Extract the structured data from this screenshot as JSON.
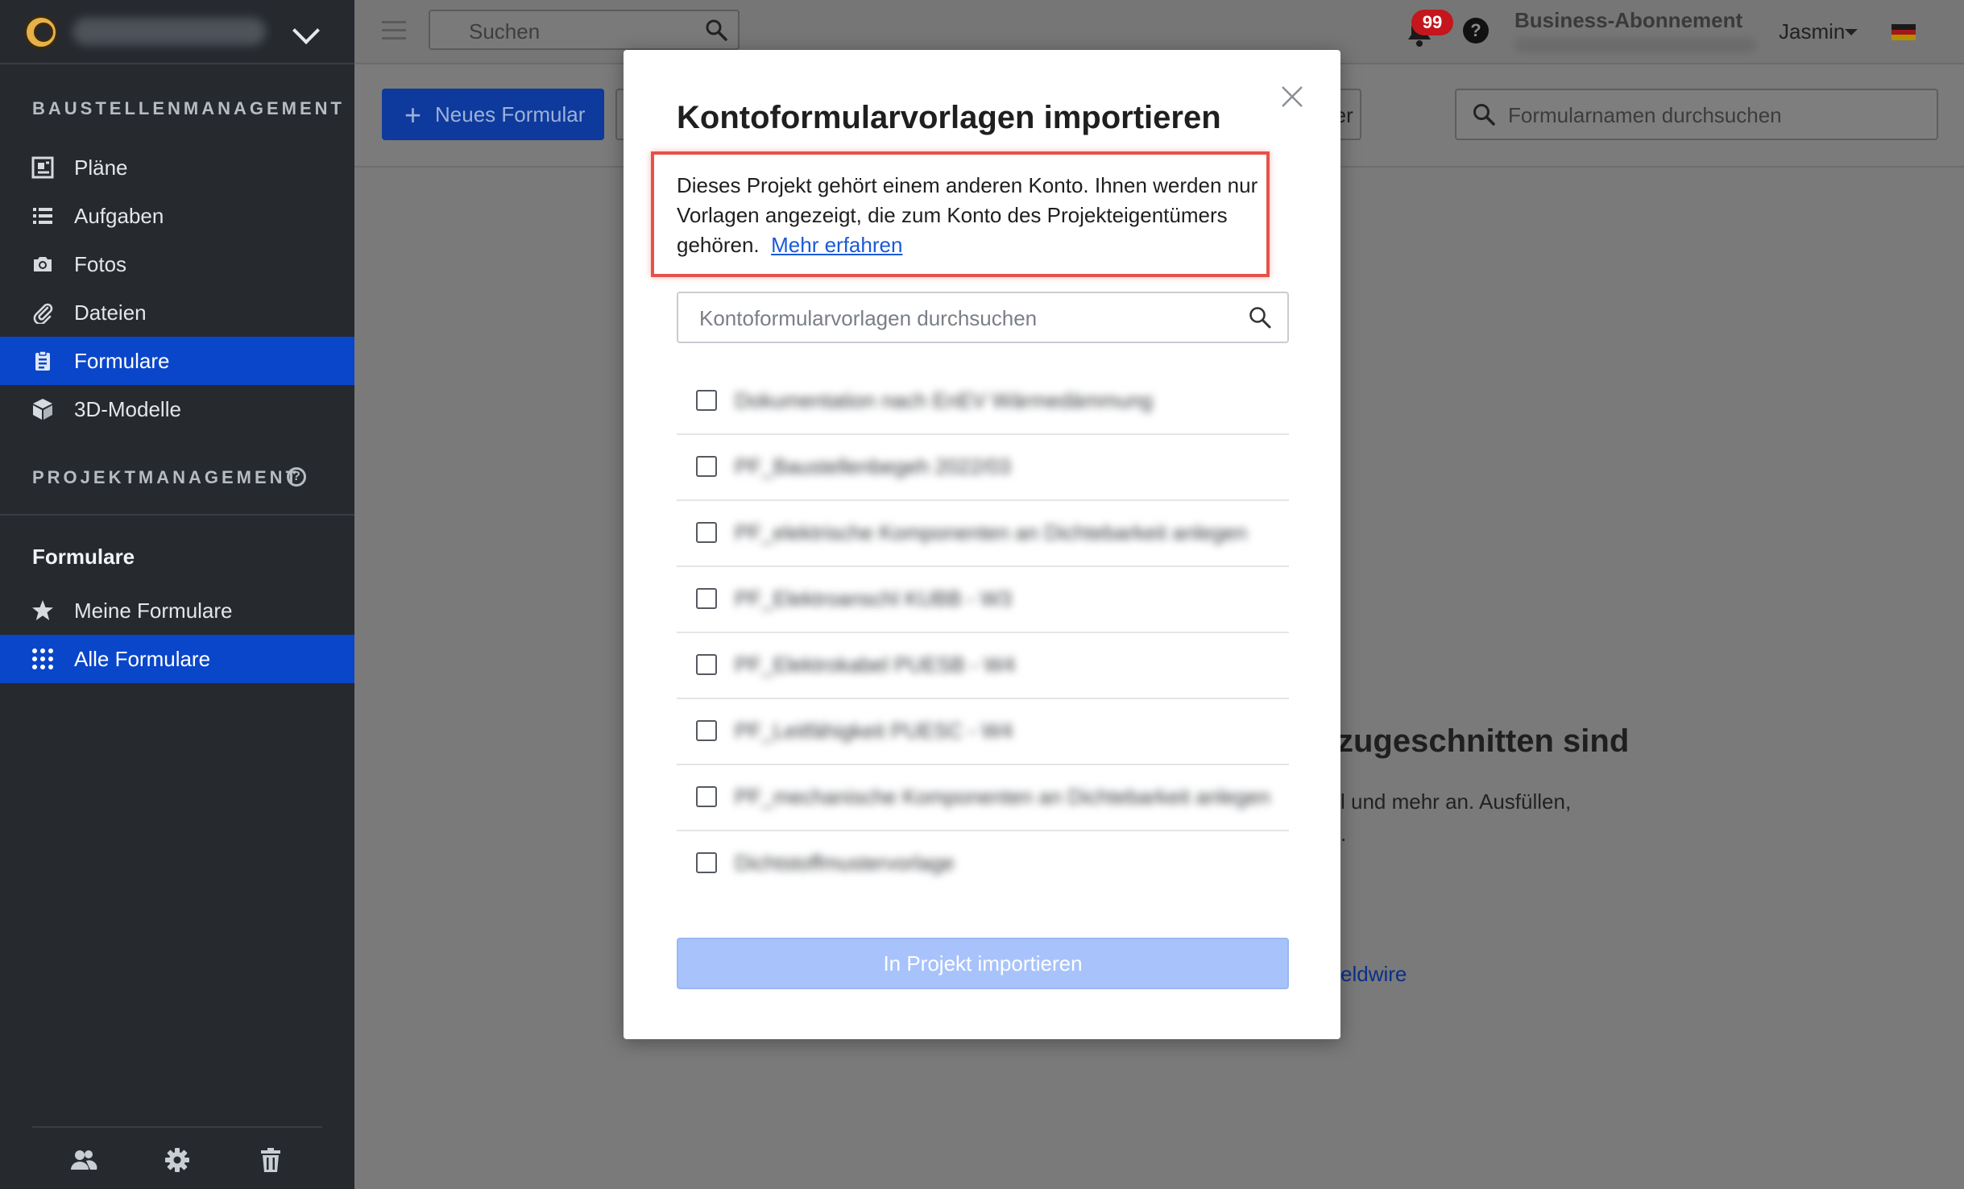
{
  "sidebar": {
    "section_site": "BAUSTELLENMANAGEMENT",
    "items": [
      {
        "label": "Pläne",
        "icon": "plans-icon"
      },
      {
        "label": "Aufgaben",
        "icon": "tasks-list-icon"
      },
      {
        "label": "Fotos",
        "icon": "camera-icon"
      },
      {
        "label": "Dateien",
        "icon": "paperclip-icon"
      },
      {
        "label": "Formulare",
        "icon": "clipboard-icon",
        "active": true
      },
      {
        "label": "3D-Modelle",
        "icon": "cube-icon"
      }
    ],
    "section_project": "PROJEKTMANAGEMENT",
    "forms_title": "Formulare",
    "forms_items": [
      {
        "label": "Meine Formulare",
        "icon": "star-icon"
      },
      {
        "label": "Alle Formulare",
        "icon": "grid-dots-icon",
        "active": true
      }
    ]
  },
  "topbar": {
    "search_placeholder": "Suchen",
    "notifications_count": "99",
    "plan_label": "Business-Abonnement",
    "user_name": "Jasmin"
  },
  "toolbar": {
    "new_form_label": "Neues Formular",
    "filter_label": "Filter",
    "form_search_placeholder": "Formularnamen durchsuchen"
  },
  "background": {
    "heading_fragment": "zugeschnitten sind",
    "text_fragment_1": "l und mehr an. Ausfüllen,",
    "text_fragment_2": ".",
    "link_fragment": "eldwire"
  },
  "modal": {
    "title": "Kontoformularvorlagen importieren",
    "notice_text": "Dieses Projekt gehört einem anderen Konto. Ihnen werden nur Vorlagen angezeigt, die zum Konto des Projekteigentümers gehören.",
    "notice_link": "Mehr erfahren",
    "search_placeholder": "Kontoformularvorlagen durchsuchen",
    "templates": [
      "Dokumentation nach EnEV Wärmedämmung",
      "PF_Baustellenbegeh 2022/03",
      "PF_elektrische Komponenten an Dichtebarkeit anlegen",
      "PF_Elektroanschl KUBB - W3",
      "PF_Elektrokabel PUESB - W4",
      "PF_Leitfähigkeit PUESC - W4",
      "PF_mechanische Komponenten an Dichtebarkeit anlegen",
      "Dichtstoffmustervorlage"
    ],
    "import_button": "In Projekt importieren"
  }
}
